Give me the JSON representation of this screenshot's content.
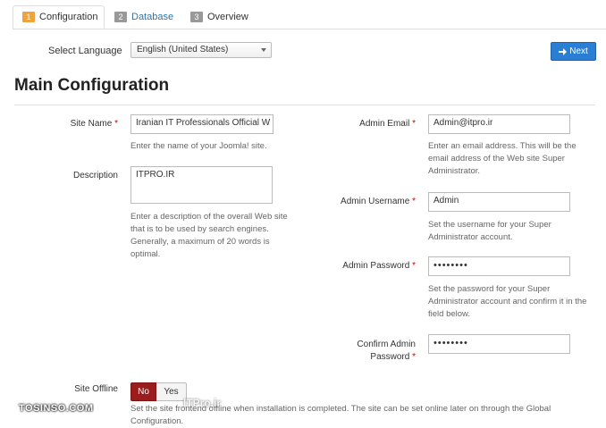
{
  "tabs": [
    {
      "num": "1",
      "label": "Configuration"
    },
    {
      "num": "2",
      "label": "Database"
    },
    {
      "num": "3",
      "label": "Overview"
    }
  ],
  "language": {
    "label": "Select Language",
    "value": "English (United States)"
  },
  "next_label": "Next",
  "section_title": "Main Configuration",
  "site_name": {
    "label": "Site Name",
    "required": "*",
    "value": "Iranian IT Professionals Official W",
    "help": "Enter the name of your Joomla! site."
  },
  "description": {
    "label": "Description",
    "value": "ITPRO.IR",
    "help": "Enter a description of the overall Web site that is to be used by search engines. Generally, a maximum of 20 words is optimal."
  },
  "admin_email": {
    "label": "Admin Email",
    "required": "*",
    "value": "Admin@itpro.ir",
    "help": "Enter an email address. This will be the email address of the Web site Super Administrator."
  },
  "admin_username": {
    "label": "Admin Username",
    "required": "*",
    "value": "Admin",
    "help": "Set the username for your Super Administrator account."
  },
  "admin_password": {
    "label": "Admin Password",
    "required": "*",
    "value": "••••••••",
    "help": "Set the password for your Super Administrator account and confirm it in the field below."
  },
  "confirm_password": {
    "label_line1": "Confirm Admin",
    "label_line2": "Password",
    "required": "*",
    "value": "••••••••"
  },
  "site_offline": {
    "label": "Site Offline",
    "no": "No",
    "yes": "Yes",
    "help": "Set the site frontend offline when installation is completed. The site can be set online later on through the Global Configuration."
  },
  "watermark": {
    "left": "TOSINSO.COM",
    "right": "ITPro.ir"
  },
  "colors": {
    "accent": "#2a7ed3",
    "active_step": "#f0a33a",
    "offline_no": "#9b1c1c"
  }
}
